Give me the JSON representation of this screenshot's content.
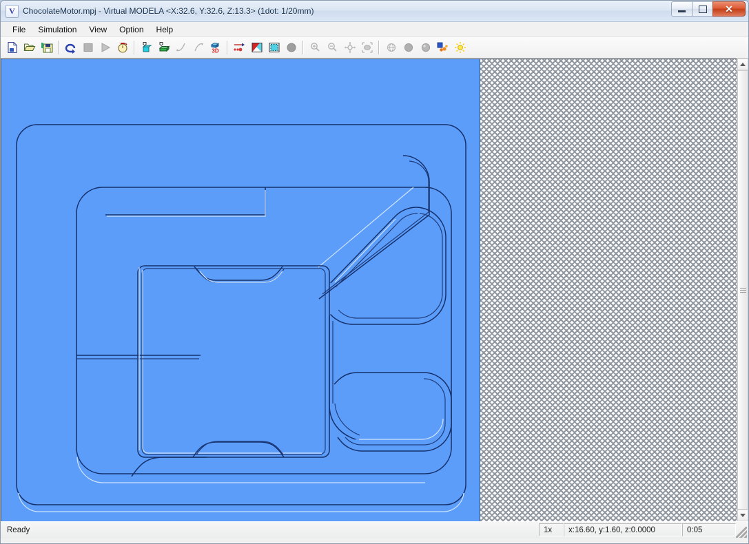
{
  "window": {
    "title": "ChocolateMotor.mpj - Virtual MODELA <X:32.6, Y:32.6, Z:13.3>  (1dot: 1/20mm)",
    "logo_letter": "V",
    "caption": {
      "minimize": "minimize",
      "maximize": "maximize",
      "close": "✕"
    }
  },
  "menubar": {
    "items": [
      {
        "label": "File"
      },
      {
        "label": "Simulation"
      },
      {
        "label": "View"
      },
      {
        "label": "Option"
      },
      {
        "label": "Help"
      }
    ]
  },
  "toolbar": {
    "groups": [
      {
        "buttons": [
          {
            "name": "new-file-button",
            "icon": "new-document-icon",
            "enabled": true
          },
          {
            "name": "open-file-button",
            "icon": "open-folder-icon",
            "enabled": true
          },
          {
            "name": "save-as-button",
            "icon": "save-floppy-icon",
            "enabled": true
          }
        ]
      },
      {
        "buttons": [
          {
            "name": "rewind-button",
            "icon": "curved-arrow-icon",
            "enabled": true
          },
          {
            "name": "stop-button",
            "icon": "stop-square-icon",
            "enabled": false
          },
          {
            "name": "play-button",
            "icon": "play-triangle-icon",
            "enabled": false
          },
          {
            "name": "speed-button",
            "icon": "stopwatch-icon",
            "enabled": true
          }
        ]
      },
      {
        "buttons": [
          {
            "name": "show-workpiece-button",
            "icon": "cyan-cube-icon",
            "enabled": true
          },
          {
            "name": "show-model-button",
            "icon": "green-block-icon",
            "enabled": true
          },
          {
            "name": "rotate-left-button",
            "icon": "rotate-ccw-icon",
            "enabled": false
          },
          {
            "name": "rotate-right-button",
            "icon": "rotate-cw-icon",
            "enabled": false
          },
          {
            "name": "view-3d-button",
            "icon": "3d-view-icon",
            "enabled": true,
            "label": "3D"
          }
        ]
      },
      {
        "buttons": [
          {
            "name": "toolpath-button",
            "icon": "toolpath-arrow-icon",
            "enabled": true
          },
          {
            "name": "section-view-button",
            "icon": "section-triangle-icon",
            "enabled": true
          },
          {
            "name": "top-view-button",
            "icon": "dotted-square-icon",
            "enabled": true
          },
          {
            "name": "solid-view-button",
            "icon": "filled-circle-icon",
            "enabled": true
          }
        ]
      },
      {
        "buttons": [
          {
            "name": "zoom-in-button",
            "icon": "zoom-in-icon",
            "enabled": false
          },
          {
            "name": "zoom-out-button",
            "icon": "zoom-out-icon",
            "enabled": false
          },
          {
            "name": "pan-button",
            "icon": "pan-move-icon",
            "enabled": false
          },
          {
            "name": "fit-view-button",
            "icon": "fit-view-icon",
            "enabled": false
          }
        ]
      },
      {
        "buttons": [
          {
            "name": "globe-view-button",
            "icon": "globe-icon",
            "enabled": false
          },
          {
            "name": "shading-flat-button",
            "icon": "gray-circle-icon",
            "enabled": false
          },
          {
            "name": "shading-smooth-button",
            "icon": "gray-sphere-icon",
            "enabled": false
          },
          {
            "name": "material-button",
            "icon": "material-swatch-icon",
            "enabled": true
          },
          {
            "name": "light-button",
            "icon": "light-bulb-icon",
            "enabled": true
          }
        ]
      }
    ]
  },
  "canvas": {
    "workpiece_color": "#5c9dfa",
    "outline_color": "#1a2e63",
    "highlight_color": "#cfe4ff",
    "background": "hatched-gray",
    "model_name": "milled-pocket-model"
  },
  "scrollbar": {
    "up_arrow": "scroll-up",
    "down_arrow": "scroll-down"
  },
  "statusbar": {
    "message": "Ready",
    "zoom": "1x",
    "coordinates": "x:16.60, y:1.60, z:0.0000",
    "elapsed": "0:05"
  }
}
